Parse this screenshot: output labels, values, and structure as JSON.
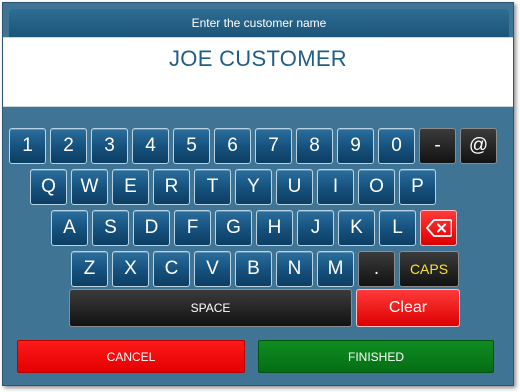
{
  "header": {
    "title": "Enter the customer name"
  },
  "name_field": {
    "value": "JOE CUSTOMER"
  },
  "keyboard": {
    "row1": [
      "1",
      "2",
      "3",
      "4",
      "5",
      "6",
      "7",
      "8",
      "9",
      "0",
      "-",
      "@"
    ],
    "row2": [
      "Q",
      "W",
      "E",
      "R",
      "T",
      "Y",
      "U",
      "I",
      "O",
      "P"
    ],
    "row3": [
      "A",
      "S",
      "D",
      "F",
      "G",
      "H",
      "J",
      "K",
      "L"
    ],
    "row4": [
      "Z",
      "X",
      "C",
      "V",
      "B",
      "N",
      "M",
      "."
    ],
    "caps_label": "CAPS",
    "space_label": "SPACE",
    "clear_label": "Clear",
    "backspace_icon": "backspace-icon"
  },
  "actions": {
    "cancel_label": "CANCEL",
    "finished_label": "FINISHED"
  },
  "colors": {
    "key_blue": "#15507c",
    "key_dark": "#1e1e1e",
    "key_red": "#ee0000",
    "caps_text": "#f7e433",
    "cancel": "#f00000",
    "finished": "#0a7d1a",
    "background": "#3f7495",
    "name_text": "#1f5f86"
  }
}
